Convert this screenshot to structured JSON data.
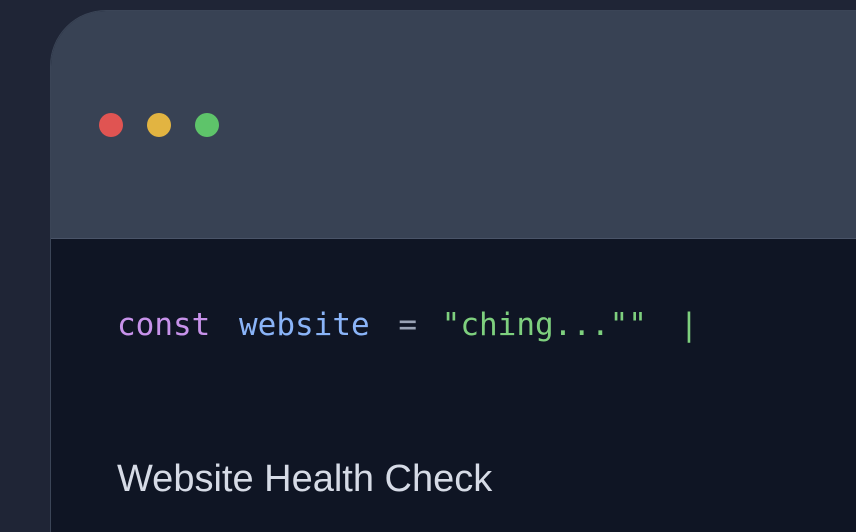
{
  "window": {
    "controls": {
      "close_color": "#e05452",
      "minimize_color": "#e2b441",
      "maximize_color": "#5ec46a"
    }
  },
  "code": {
    "keyword": "const",
    "variable": "website",
    "operator": "=",
    "string": "\"ching...\"\"",
    "cursor": "|",
    "colors": {
      "keyword": "#c792ea",
      "variable": "#8ab4f8",
      "operator": "#9aa3b5",
      "string": "#7ed07e",
      "cursor": "#7ed07e"
    }
  },
  "heading": {
    "text": "Website Health Check",
    "color": "#d6dbe6"
  }
}
